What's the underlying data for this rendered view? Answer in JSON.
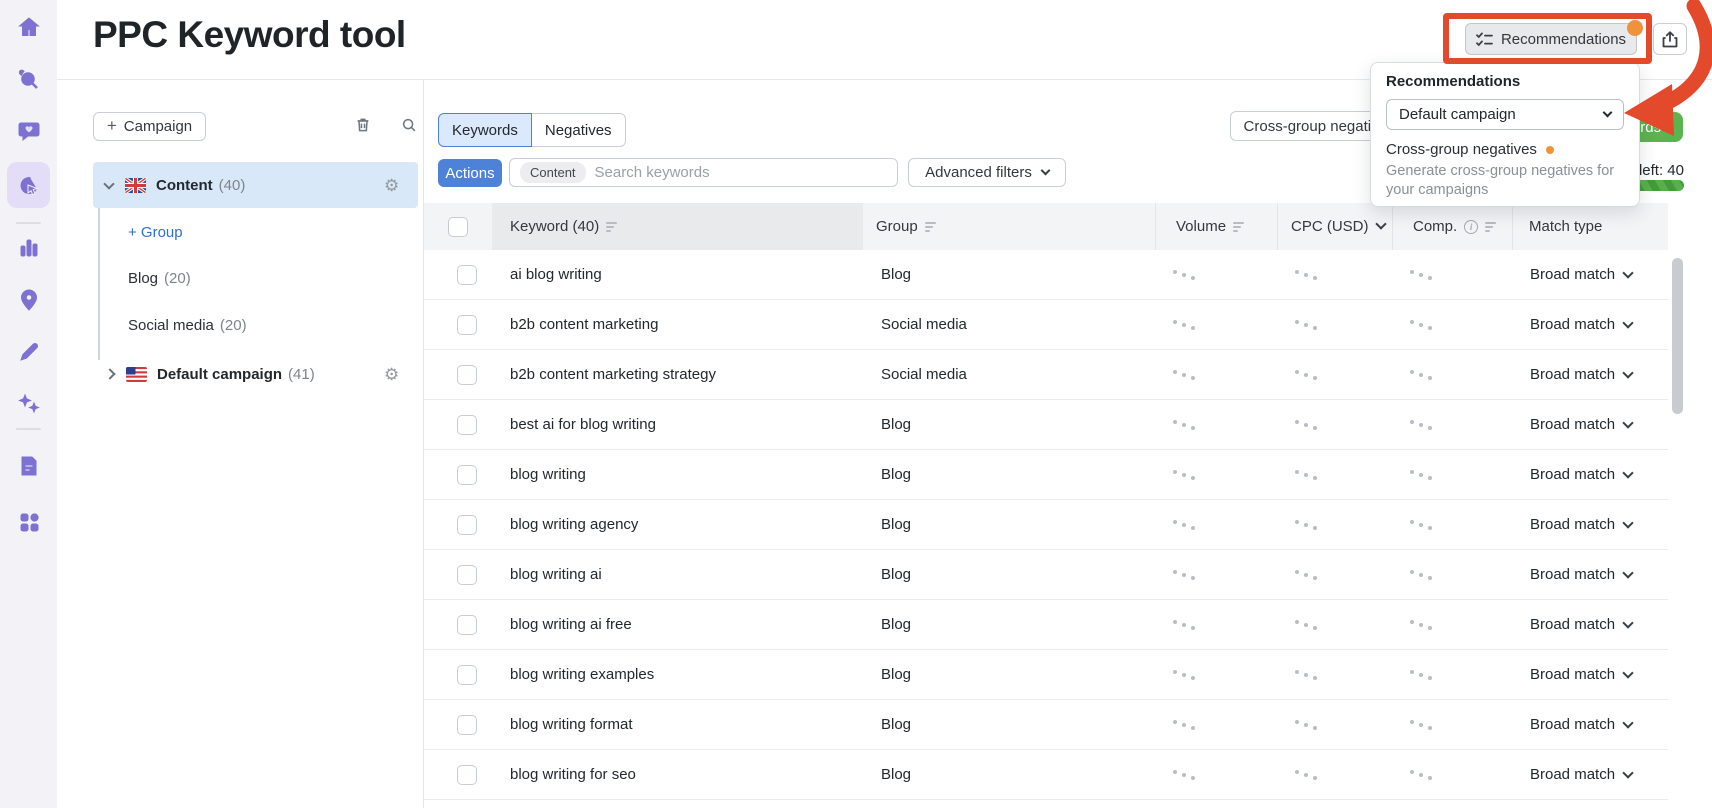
{
  "page": {
    "title": "PPC Keyword tool"
  },
  "sidebar": {
    "items": [
      "home",
      "research",
      "feedback",
      "ppc-tool (active)",
      "analytics",
      "local-marketing",
      "content-editor",
      "ai-tools",
      "reports",
      "apps"
    ]
  },
  "topbar": {
    "recommendations_label": "Recommendations",
    "export_icon": "export-upload",
    "notification_dot_color": "#f0913c"
  },
  "popup": {
    "title": "Recommendations",
    "campaign_select_value": "Default campaign",
    "item_title": "Cross-group negatives",
    "item_desc_line1": "Generate cross-group negatives for",
    "item_desc_line2": "your campaigns"
  },
  "left_panel": {
    "campaign_button_label": "Campaign",
    "icons": [
      "trash-icon",
      "search-icon"
    ],
    "tree": {
      "campaigns": [
        {
          "name": "Content",
          "count": "(40)",
          "flag": "uk",
          "state": "expanded"
        },
        {
          "name": "Default campaign",
          "count": "(41)",
          "flag": "us",
          "state": "collapsed"
        }
      ],
      "add_group_label": "+ Group",
      "groups": [
        {
          "name": "Blog",
          "count": "(20)"
        },
        {
          "name": "Social media",
          "count": "(20)"
        }
      ]
    }
  },
  "toolbar": {
    "tabs": [
      "Keywords",
      "Negatives"
    ],
    "active_tab": "Keywords",
    "actions_label": "Actions",
    "search_tag": "Content",
    "search_placeholder": "Search keywords",
    "advanced_filters_label": "Advanced filters",
    "cross_group_button_label": "Cross-group negatives",
    "add_keywords_button_label": "Add keywords",
    "keywords_left_label": "Keywords left: 40"
  },
  "table": {
    "headers": {
      "keyword": "Keyword (40)",
      "group": "Group",
      "volume": "Volume",
      "cpc": "CPC (USD)",
      "competition": "Comp.",
      "match_type": "Match type"
    },
    "rows": [
      {
        "keyword": "ai blog writing",
        "group": "Blog",
        "match_type": "Broad match"
      },
      {
        "keyword": "b2b content marketing",
        "group": "Social media",
        "match_type": "Broad match"
      },
      {
        "keyword": "b2b content marketing strategy",
        "group": "Social media",
        "match_type": "Broad match"
      },
      {
        "keyword": "best ai for blog writing",
        "group": "Blog",
        "match_type": "Broad match"
      },
      {
        "keyword": "blog writing",
        "group": "Blog",
        "match_type": "Broad match"
      },
      {
        "keyword": "blog writing agency",
        "group": "Blog",
        "match_type": "Broad match"
      },
      {
        "keyword": "blog writing ai",
        "group": "Blog",
        "match_type": "Broad match"
      },
      {
        "keyword": "blog writing ai free",
        "group": "Blog",
        "match_type": "Broad match"
      },
      {
        "keyword": "blog writing examples",
        "group": "Blog",
        "match_type": "Broad match"
      },
      {
        "keyword": "blog writing format",
        "group": "Blog",
        "match_type": "Broad match"
      },
      {
        "keyword": "blog writing for seo",
        "group": "Blog",
        "match_type": "Broad match"
      }
    ]
  },
  "annotations": {
    "highlight_color": "#e3492b",
    "accent_blue": "#4d82d8",
    "accent_green": "#5cb450",
    "accent_orange": "#f0913c",
    "accent_purple": "#7e71d1"
  }
}
